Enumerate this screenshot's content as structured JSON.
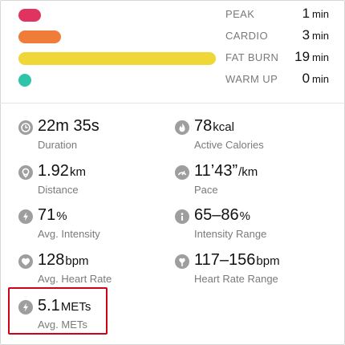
{
  "zones": [
    {
      "name": "PEAK",
      "value": "1",
      "unit": "min",
      "color": "#e0335f",
      "fill": 0.05
    },
    {
      "name": "CARDIO",
      "value": "3",
      "unit": "min",
      "color": "#f07c3a",
      "fill": 0.16
    },
    {
      "name": "FAT BURN",
      "value": "19",
      "unit": "min",
      "color": "#efd738",
      "fill": 1.0
    },
    {
      "name": "WARM UP",
      "value": "0",
      "unit": "min",
      "color": "#2ec4a8",
      "fill": 0
    }
  ],
  "stats": {
    "duration": {
      "value": "22m 35s",
      "unit": "",
      "label": "Duration",
      "icon": "clock-icon"
    },
    "active_calories": {
      "value": "78",
      "unit": "kcal",
      "label": "Active Calories",
      "icon": "flame-icon"
    },
    "distance": {
      "value": "1.92",
      "unit": "km",
      "label": "Distance",
      "icon": "location-pin-icon"
    },
    "pace": {
      "value": "11’43”",
      "unit": "/km",
      "label": "Pace",
      "icon": "speedometer-icon"
    },
    "intensity": {
      "value": "71",
      "unit": "%",
      "label": "Avg. Intensity",
      "icon": "bolt-icon"
    },
    "intensity_range": {
      "value": "65–86",
      "unit": "%",
      "label": "Intensity Range",
      "icon": "info-icon"
    },
    "heart_rate": {
      "value": "128",
      "unit": "bpm",
      "label": "Avg. Heart Rate",
      "icon": "heart-icon"
    },
    "heart_rate_range": {
      "value": "117–156",
      "unit": "bpm",
      "label": "Heart Rate Range",
      "icon": "heart-range-icon"
    },
    "mets": {
      "value": "5.1",
      "unit": "METs",
      "label": "Avg. METs",
      "icon": "bolt-icon"
    }
  },
  "colors": {
    "highlight": "#d0021b",
    "icon": "#9e9e9e",
    "label": "#7a7a7a"
  }
}
